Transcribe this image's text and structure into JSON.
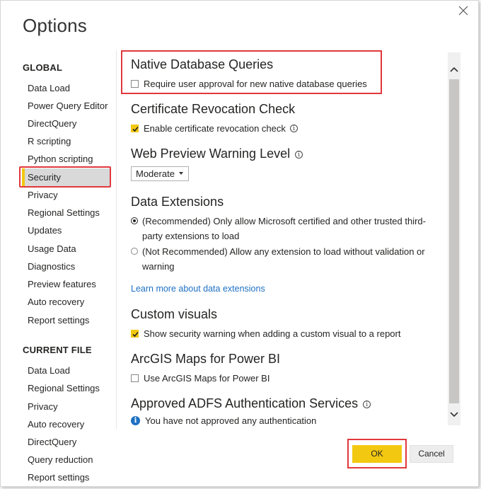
{
  "dialog": {
    "title": "Options"
  },
  "nav": {
    "global_heading": "GLOBAL",
    "global_items": [
      "Data Load",
      "Power Query Editor",
      "DirectQuery",
      "R scripting",
      "Python scripting",
      "Security",
      "Privacy",
      "Regional Settings",
      "Updates",
      "Usage Data",
      "Diagnostics",
      "Preview features",
      "Auto recovery",
      "Report settings"
    ],
    "selected": "Security",
    "current_heading": "CURRENT FILE",
    "current_items": [
      "Data Load",
      "Regional Settings",
      "Privacy",
      "Auto recovery",
      "DirectQuery",
      "Query reduction",
      "Report settings"
    ]
  },
  "content": {
    "native_db": {
      "heading": "Native Database Queries",
      "checkbox_label": "Require user approval for new native database queries",
      "checked": false
    },
    "cert": {
      "heading": "Certificate Revocation Check",
      "checkbox_label": "Enable certificate revocation check",
      "checked": true
    },
    "web_preview": {
      "heading": "Web Preview Warning Level",
      "dropdown_value": "Moderate"
    },
    "data_ext": {
      "heading": "Data Extensions",
      "option1_line1": "(Recommended) Only allow Microsoft certified and other trusted third-",
      "option1_line2": "party extensions to load",
      "option2_line1": "(Not Recommended) Allow any extension to load without validation or",
      "option2_line2": "warning",
      "selected_option": 1,
      "link": "Learn more about data extensions"
    },
    "custom_visuals": {
      "heading": "Custom visuals",
      "checkbox_label": "Show security warning when adding a custom visual to a report",
      "checked": true
    },
    "arcgis": {
      "heading": "ArcGIS Maps for Power BI",
      "checkbox_label": "Use ArcGIS Maps for Power BI",
      "checked": false
    },
    "adfs": {
      "heading": "Approved ADFS Authentication Services",
      "message": "You have not approved any authentication"
    }
  },
  "buttons": {
    "ok": "OK",
    "cancel": "Cancel"
  },
  "colors": {
    "accent": "#f2c811",
    "highlight": "#e0383c",
    "link": "#1e70c4"
  },
  "icons": {
    "close": "close-icon",
    "info": "info-icon",
    "scroll_up": "chevron-up-icon",
    "scroll_down": "chevron-down-icon"
  }
}
